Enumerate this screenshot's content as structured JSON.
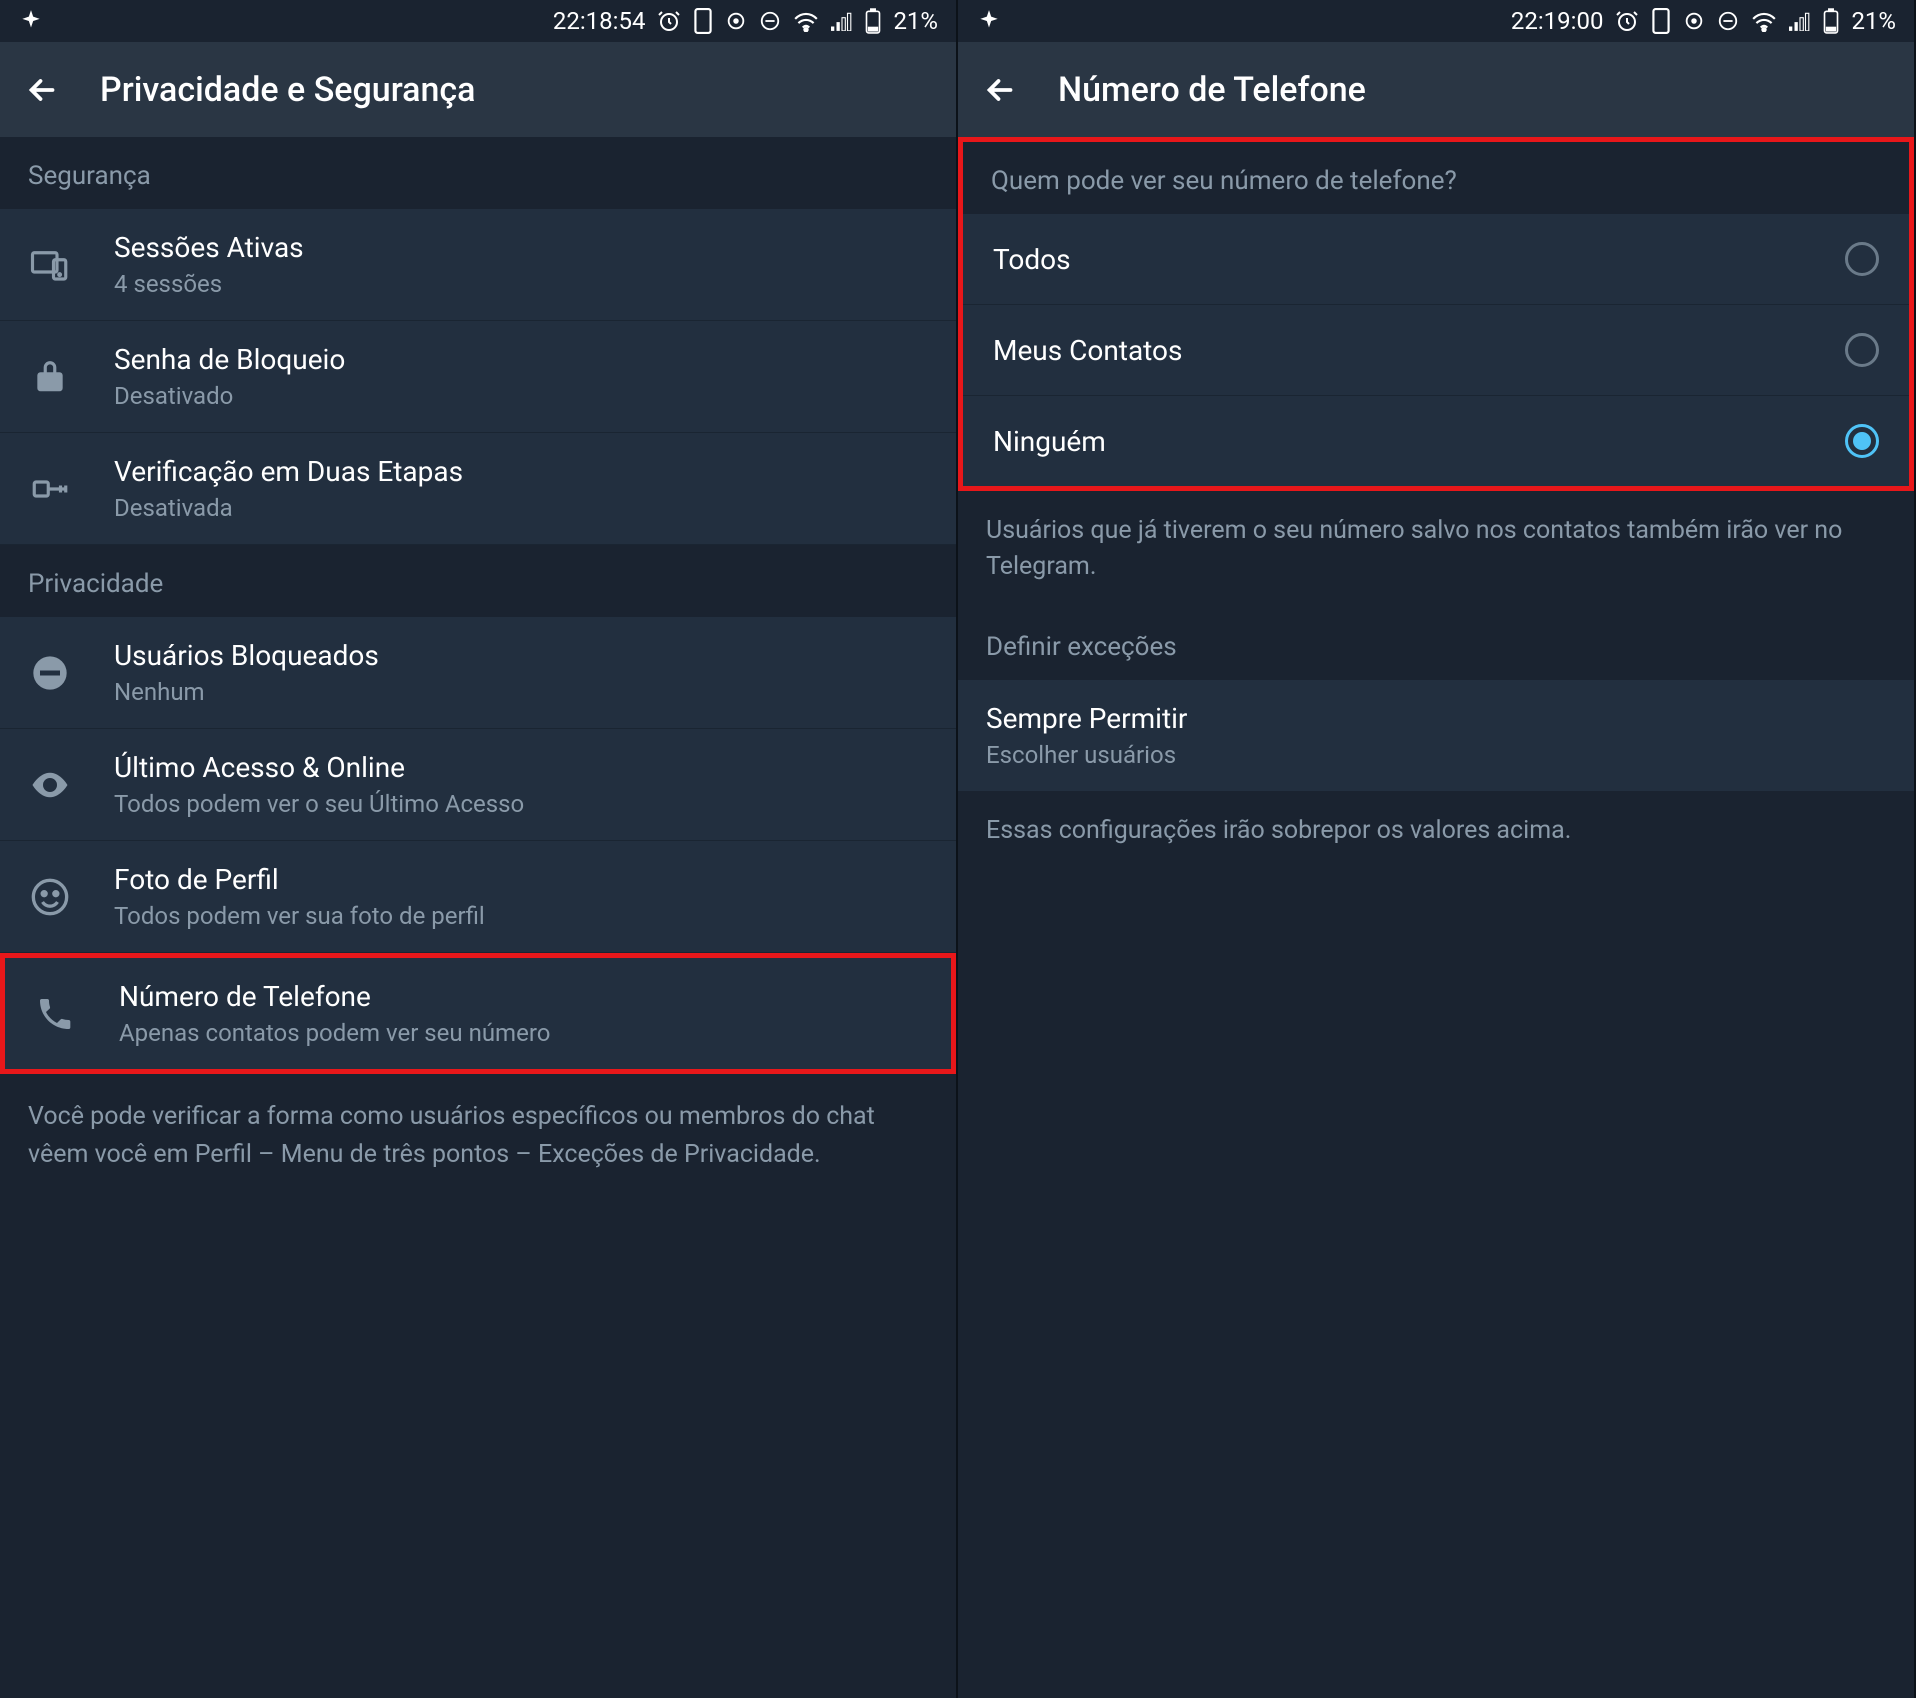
{
  "left": {
    "status": {
      "time": "22:18:54",
      "battery": "21%"
    },
    "title": "Privacidade e Segurança",
    "sec_header": "Segurança",
    "items_sec": [
      {
        "title": "Sessões Ativas",
        "sub": "4 sessões"
      },
      {
        "title": "Senha de Bloqueio",
        "sub": "Desativado"
      },
      {
        "title": "Verificação em Duas Etapas",
        "sub": "Desativada"
      }
    ],
    "priv_header": "Privacidade",
    "items_priv": [
      {
        "title": "Usuários Bloqueados",
        "sub": "Nenhum"
      },
      {
        "title": "Último Acesso & Online",
        "sub": "Todos podem ver o seu Último Acesso"
      },
      {
        "title": "Foto de Perfil",
        "sub": "Todos podem ver sua foto de perfil"
      },
      {
        "title": "Número de Telefone",
        "sub": "Apenas contatos podem ver seu número"
      }
    ],
    "footer": "Você pode verificar a forma como usuários específicos ou membros do chat vêem você em Perfil – Menu de três pontos – Exceções de Privacidade."
  },
  "right": {
    "status": {
      "time": "22:19:00",
      "battery": "21%"
    },
    "title": "Número de Telefone",
    "q_header": "Quem pode ver seu número de telefone?",
    "options": [
      {
        "label": "Todos",
        "selected": false
      },
      {
        "label": "Meus Contatos",
        "selected": false
      },
      {
        "label": "Ninguém",
        "selected": true
      }
    ],
    "info1": "Usuários que já tiverem o seu número salvo nos contatos também irão ver no Telegram.",
    "exc_header": "Definir exceções",
    "always": {
      "title": "Sempre Permitir",
      "sub": "Escolher usuários"
    },
    "info2": "Essas configurações irão sobrepor os valores acima."
  }
}
